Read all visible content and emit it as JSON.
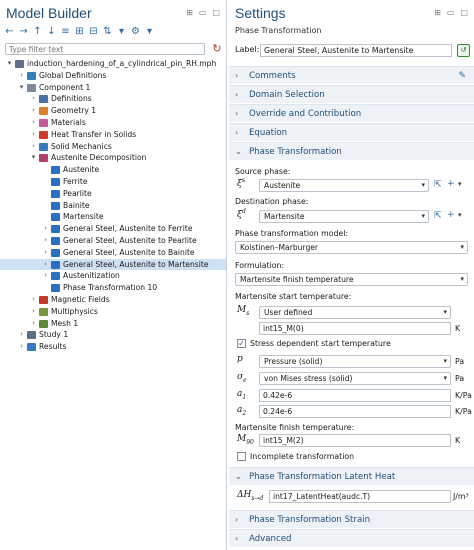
{
  "model_builder": {
    "title": "Model Builder",
    "filter_placeholder": "Type filter text",
    "tree": [
      {
        "label": "induction_hardening_of_a_cylindrical_pin_RH.mph",
        "level": 0,
        "tw": "▾",
        "icon": "file-icon",
        "color": "#5b6f86"
      },
      {
        "label": "Global Definitions",
        "level": 1,
        "tw": "›",
        "icon": "globe-icon",
        "color": "#2f7fbf"
      },
      {
        "label": "Component 1",
        "level": 1,
        "tw": "▾",
        "icon": "component-icon",
        "color": "#7a8a9a"
      },
      {
        "label": "Definitions",
        "level": 2,
        "tw": "›",
        "icon": "definitions-icon",
        "color": "#4a6fa5"
      },
      {
        "label": "Geometry 1",
        "level": 2,
        "tw": "›",
        "icon": "geometry-icon",
        "color": "#d9822b"
      },
      {
        "label": "Materials",
        "level": 2,
        "tw": "›",
        "icon": "materials-icon",
        "color": "#c85a9a"
      },
      {
        "label": "Heat Transfer in Solids",
        "level": 2,
        "tw": "›",
        "icon": "heat-transfer-icon",
        "color": "#d03b2a"
      },
      {
        "label": "Solid Mechanics",
        "level": 2,
        "tw": "›",
        "icon": "solid-mechanics-icon",
        "color": "#3a79c2"
      },
      {
        "label": "Austenite Decomposition",
        "level": 2,
        "tw": "▾",
        "icon": "austenite-decomposition-icon",
        "color": "#b04070"
      },
      {
        "label": "Austenite",
        "level": 3,
        "tw": "",
        "icon": "phase-icon",
        "color": "#2a6fc2"
      },
      {
        "label": "Ferrite",
        "level": 3,
        "tw": "",
        "icon": "phase-icon",
        "color": "#2a6fc2"
      },
      {
        "label": "Pearlite",
        "level": 3,
        "tw": "",
        "icon": "phase-icon",
        "color": "#2a6fc2"
      },
      {
        "label": "Bainite",
        "level": 3,
        "tw": "",
        "icon": "phase-icon",
        "color": "#2a6fc2"
      },
      {
        "label": "Martensite",
        "level": 3,
        "tw": "",
        "icon": "phase-icon",
        "color": "#2a6fc2"
      },
      {
        "label": "General Steel, Austenite to Ferrite",
        "level": 3,
        "tw": "›",
        "icon": "transformation-icon",
        "color": "#2a6fc2"
      },
      {
        "label": "General Steel, Austenite to Pearlite",
        "level": 3,
        "tw": "›",
        "icon": "transformation-icon",
        "color": "#2a6fc2"
      },
      {
        "label": "General Steel, Austenite to Bainite",
        "level": 3,
        "tw": "›",
        "icon": "transformation-icon",
        "color": "#2a6fc2"
      },
      {
        "label": "General Steel, Austenite to Martensite",
        "level": 3,
        "tw": "›",
        "icon": "transformation-icon",
        "color": "#2a6fc2",
        "selected": true
      },
      {
        "label": "Austenitization",
        "level": 3,
        "tw": "›",
        "icon": "transformation-icon",
        "color": "#2a6fc2"
      },
      {
        "label": "Phase Transformation 10",
        "level": 3,
        "tw": "",
        "icon": "transformation-icon",
        "color": "#2a6fc2"
      },
      {
        "label": "Magnetic Fields",
        "level": 2,
        "tw": "›",
        "icon": "magnetic-fields-icon",
        "color": "#c0392b"
      },
      {
        "label": "Multiphysics",
        "level": 2,
        "tw": "›",
        "icon": "multiphysics-icon",
        "color": "#7a9a3a"
      },
      {
        "label": "Mesh 1",
        "level": 2,
        "tw": "›",
        "icon": "mesh-icon",
        "color": "#5a8a3a"
      },
      {
        "label": "Study 1",
        "level": 1,
        "tw": "›",
        "icon": "study-icon",
        "color": "#5b6f86"
      },
      {
        "label": "Results",
        "level": 1,
        "tw": "›",
        "icon": "results-icon",
        "color": "#3a79c2"
      }
    ]
  },
  "settings": {
    "title": "Settings",
    "subtitle": "Phase Transformation",
    "label_caption": "Label:",
    "label_value": "General Steel, Austenite to Martensite",
    "sections": {
      "comments": "Comments",
      "domain_selection": "Domain Selection",
      "override": "Override and Contribution",
      "equation": "Equation",
      "phase_transformation": "Phase Transformation",
      "latent_heat": "Phase Transformation Latent Heat",
      "strain": "Phase Transformation Strain",
      "advanced": "Advanced"
    },
    "source_phase_label": "Source phase:",
    "source_phase_value": "Austenite",
    "destination_phase_label": "Destination phase:",
    "destination_phase_value": "Martensite",
    "model_label": "Phase transformation model:",
    "model_value": "Koistinen–Marburger",
    "formulation_label": "Formulation:",
    "formulation_value": "Martensite finish temperature",
    "ms_label": "Martensite start temperature:",
    "ms_select": "User defined",
    "ms_value": "int15_M(0)",
    "ms_unit": "K",
    "stress_dep_label": "Stress dependent start temperature",
    "p_select": "Pressure (solid)",
    "p_unit": "Pa",
    "sigma_select": "von Mises stress (solid)",
    "sigma_unit": "Pa",
    "a1_value": "0.42e-6",
    "a1_unit": "K/Pa",
    "a2_value": "0.24e-6",
    "a2_unit": "K/Pa",
    "mf_label": "Martensite finish temperature:",
    "m90_value": "int15_M(2)",
    "m90_unit": "K",
    "incomplete_label": "Incomplete transformation",
    "latent_value": "int17_LatentHeat(audc.T)",
    "latent_unit": "J/m³"
  }
}
